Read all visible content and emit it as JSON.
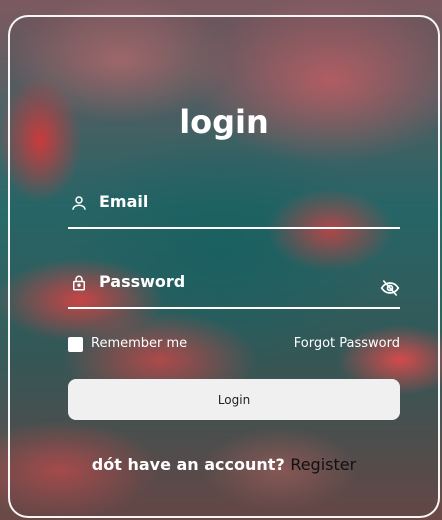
{
  "form": {
    "title": "login",
    "email_label": "Email",
    "password_label": "Password",
    "remember_label": "Remember me",
    "forgot_label": "Forgot Password",
    "login_button": "Login",
    "register_prompt": "dót have an account?",
    "register_link": "Register",
    "remember_checked": false
  },
  "icons": {
    "email": "user-icon",
    "password": "lock-icon",
    "visibility": "eye-off-icon"
  },
  "colors": {
    "text": "#ffffff",
    "button_bg": "#f0f0f0",
    "link": "#111111"
  }
}
